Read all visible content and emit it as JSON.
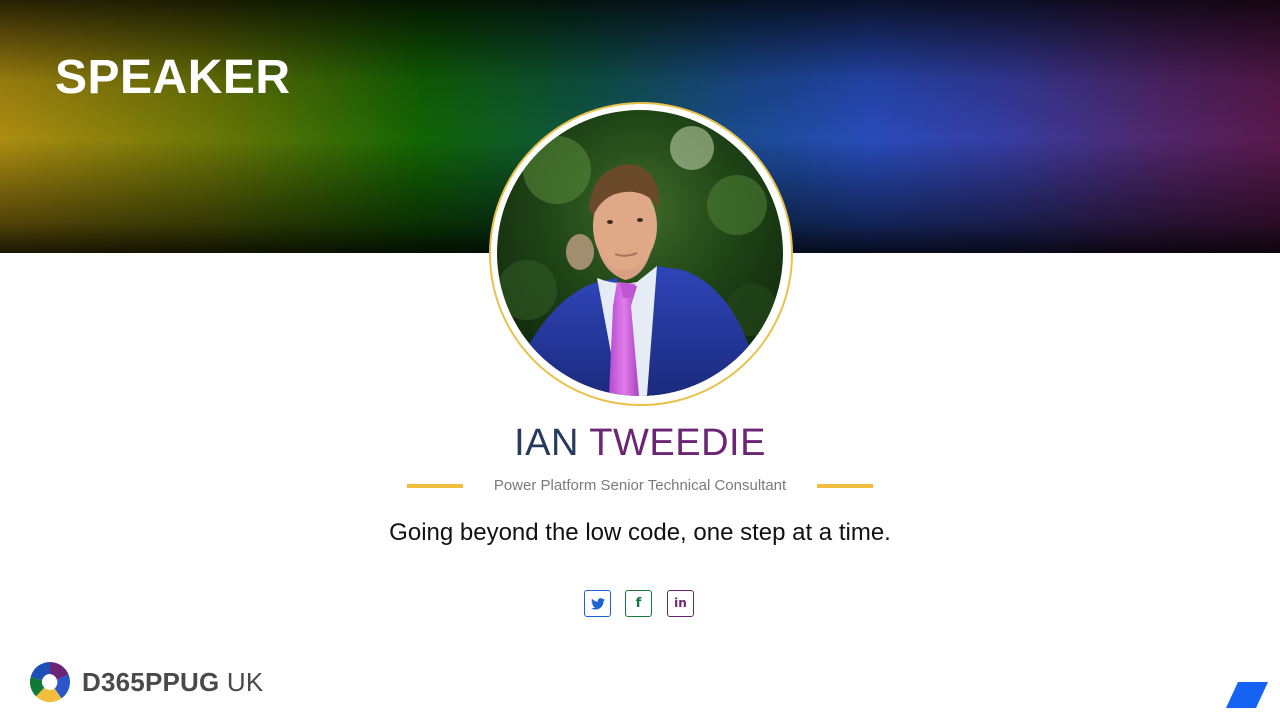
{
  "banner": {
    "title": "SPEAKER"
  },
  "speaker": {
    "first_name": "IAN",
    "last_name": "TWEEDIE",
    "role": "Power Platform Senior Technical Consultant",
    "tagline": "Going beyond the low code, one step at a time.",
    "photo_icon": "speaker-portrait"
  },
  "social": [
    {
      "icon": "twitter-icon",
      "color": "#1e63d6"
    },
    {
      "icon": "facebook-icon",
      "color": "#157a3c",
      "glyph": "f"
    },
    {
      "icon": "linkedin-icon",
      "color": "#6b2574",
      "glyph": "in"
    }
  ],
  "logo": {
    "bold_text": "D365PPUG",
    "regular_text": " UK",
    "icon": "aperture-logo-icon"
  },
  "colors": {
    "accent_gold": "#f0bd3c",
    "name_navy": "#263a5e",
    "name_purple": "#6b2574",
    "corner_blue": "#1463f3"
  }
}
